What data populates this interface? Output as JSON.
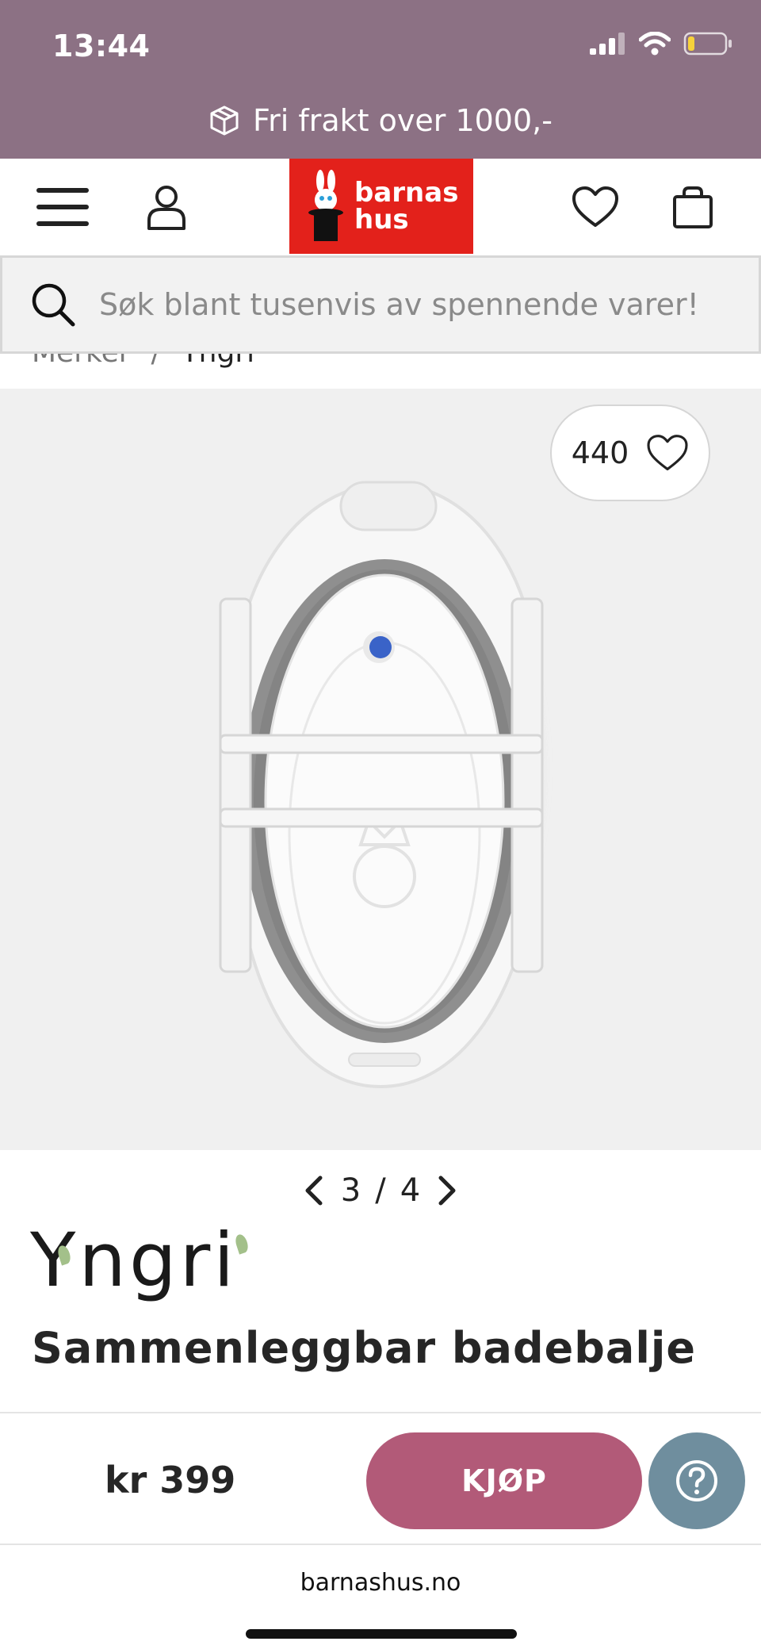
{
  "status_bar": {
    "time": "13:44"
  },
  "promo": {
    "icon": "package-icon",
    "text": "Fri frakt over 1000,-"
  },
  "header": {
    "menu_icon": "hamburger-menu-icon",
    "account_icon": "user-icon",
    "logo_text_line1": "barnas",
    "logo_text_line2": "hus",
    "wishlist_icon": "heart-icon",
    "cart_icon": "shopping-bag-icon"
  },
  "search": {
    "placeholder": "Søk blant tusenvis av spennende varer!"
  },
  "breadcrumb": {
    "parent": "Merker",
    "separator": "/",
    "current": "Yngri"
  },
  "product": {
    "favorites_count": "440",
    "image_current": "3",
    "image_separator": "/",
    "image_total": "4",
    "brand": "Yngri",
    "title": "Sammenleggbar badebalje",
    "price": "kr 399",
    "buy_label": "KJØP"
  },
  "browser": {
    "url": "barnashus.no"
  },
  "colors": {
    "top_band": "#8c7184",
    "logo_red": "#e3211b",
    "buy_button": "#b25a78",
    "help_button": "#6f8e9e",
    "gallery_bg": "#f0f0f0"
  }
}
